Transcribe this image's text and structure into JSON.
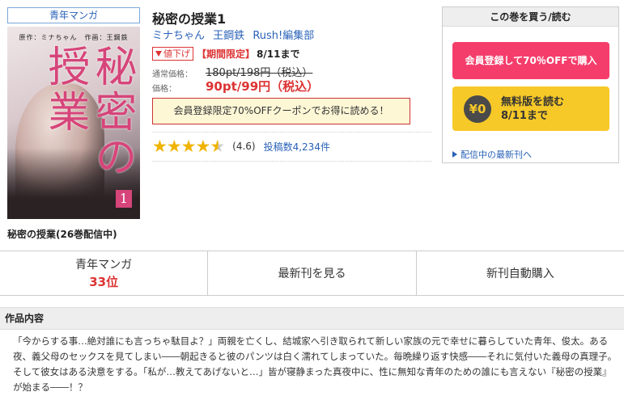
{
  "genre_tag": "青年マンガ",
  "cover": {
    "credit": "原作：ミナちゃん　作画：王鋼鉄",
    "title": "秘密の授業",
    "volume": "1"
  },
  "series_name": "秘密の授業(26巻配信中)",
  "product": {
    "title": "秘密の授業1",
    "authors": [
      "ミナちゃん",
      "王鋼鉄",
      "Rush!編集部"
    ],
    "price_down_badge": "値下げ",
    "limited_label": "【期間限定】",
    "limited_until": "8/11まで",
    "regular_price_label": "通常価格：",
    "regular_price": "180pt/198円（税込）",
    "price_label": "価格：",
    "price": "90pt/99円（税込）",
    "coupon_text": "会員登録限定70%OFFクーポンでお得に読める！",
    "rating_value": 4.6,
    "rating_text": "(4.6)",
    "review_count": "投稿数4,234件"
  },
  "buybox": {
    "header": "この巻を買う/読む",
    "member_button": "会員登録して70％OFFで購入",
    "free_icon": "¥0",
    "free_line1": "無料版を読む",
    "free_line2": "8/11まで",
    "latest_link": "配信中の最新刊へ"
  },
  "actions": {
    "ranking_genre": "青年マンガ",
    "ranking_rank": "33位",
    "latest": "最新刊を見る",
    "auto_buy": "新刊自動購入"
  },
  "description": {
    "heading": "作品内容",
    "body": "「今からする事…絶対誰にも言っちゃ駄目よ？」両親を亡くし、結城家へ引き取られて新しい家族の元で幸せに暮らしていた青年、俊太。ある夜、義父母のセックスを見てしまい――朝起きると彼のパンツは白く濡れてしまっていた。毎晩繰り返す快感――それに気付いた義母の真理子。そして彼女はある決意をする。「私が…教えてあげないと…」皆が寝静まった真夜中に、性に無知な青年のための誰にも言えない『秘密の授業』が始まる――！？"
  },
  "colors": {
    "accent_pink": "#f53d6b",
    "accent_yellow": "#f7c928",
    "link_blue": "#2a62b8",
    "sale_red": "#dd3333"
  }
}
